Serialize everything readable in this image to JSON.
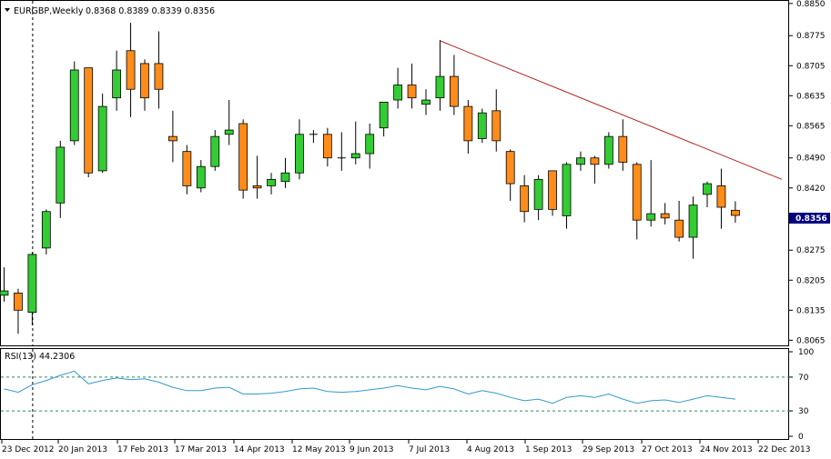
{
  "header": {
    "symbol_label": "EURGBP,Weekly",
    "ohlc_label": "0.8368 0.8389 0.8339 0.8356"
  },
  "rsi_header": {
    "label": "RSI(13) 44.2306"
  },
  "current_price_tag": "0.8356",
  "colors": {
    "bull": "#33cc33",
    "bear": "#ff8c1a",
    "candle_border": "#000000",
    "rsi_line": "#3399cc",
    "trendline": "#b22222",
    "grid": "#7f7f7f",
    "price_tag_bg": "#000080"
  },
  "chart_data": [
    {
      "type": "candlestick",
      "title": "",
      "price_axis_ticks": [
        "0.8850",
        "0.8775",
        "0.8705",
        "0.8635",
        "0.8565",
        "0.8490",
        "0.8420",
        "0.8350",
        "0.8275",
        "0.8205",
        "0.8135",
        "0.8065"
      ],
      "date_axis_ticks": [
        "23 Dec 2012",
        "20 Jan 2013",
        "17 Feb 2013",
        "17 Mar 2013",
        "14 Apr 2013",
        "12 May 2013",
        "9 Jun 2013",
        "7 Jul 2013",
        "4 Aug 2013",
        "1 Sep 2013",
        "29 Sep 2013",
        "27 Oct 2013",
        "24 Nov 2013",
        "22 Dec 2013"
      ],
      "ylim": [
        0.8053,
        0.8856
      ],
      "grid": false,
      "candles": [
        {
          "o": 0.817,
          "h": 0.8235,
          "l": 0.8155,
          "c": 0.818
        },
        {
          "o": 0.8175,
          "h": 0.8185,
          "l": 0.808,
          "c": 0.8135
        },
        {
          "o": 0.813,
          "h": 0.827,
          "l": 0.81,
          "c": 0.8265
        },
        {
          "o": 0.828,
          "h": 0.837,
          "l": 0.8265,
          "c": 0.8365
        },
        {
          "o": 0.8385,
          "h": 0.853,
          "l": 0.835,
          "c": 0.8515
        },
        {
          "o": 0.853,
          "h": 0.8715,
          "l": 0.852,
          "c": 0.8695
        },
        {
          "o": 0.87,
          "h": 0.87,
          "l": 0.8445,
          "c": 0.8455
        },
        {
          "o": 0.846,
          "h": 0.864,
          "l": 0.8455,
          "c": 0.861
        },
        {
          "o": 0.863,
          "h": 0.874,
          "l": 0.86,
          "c": 0.8695
        },
        {
          "o": 0.874,
          "h": 0.8805,
          "l": 0.8585,
          "c": 0.865
        },
        {
          "o": 0.871,
          "h": 0.872,
          "l": 0.86,
          "c": 0.863
        },
        {
          "o": 0.871,
          "h": 0.8785,
          "l": 0.8605,
          "c": 0.865
        },
        {
          "o": 0.854,
          "h": 0.86,
          "l": 0.848,
          "c": 0.853
        },
        {
          "o": 0.8505,
          "h": 0.852,
          "l": 0.8405,
          "c": 0.8425
        },
        {
          "o": 0.842,
          "h": 0.8485,
          "l": 0.841,
          "c": 0.847
        },
        {
          "o": 0.847,
          "h": 0.8555,
          "l": 0.846,
          "c": 0.854
        },
        {
          "o": 0.8545,
          "h": 0.8625,
          "l": 0.852,
          "c": 0.8555
        },
        {
          "o": 0.857,
          "h": 0.858,
          "l": 0.8395,
          "c": 0.8415
        },
        {
          "o": 0.8425,
          "h": 0.8495,
          "l": 0.8395,
          "c": 0.842
        },
        {
          "o": 0.8425,
          "h": 0.8455,
          "l": 0.8405,
          "c": 0.844
        },
        {
          "o": 0.8435,
          "h": 0.849,
          "l": 0.842,
          "c": 0.8455
        },
        {
          "o": 0.8455,
          "h": 0.858,
          "l": 0.844,
          "c": 0.8545
        },
        {
          "o": 0.8545,
          "h": 0.8555,
          "l": 0.8525,
          "c": 0.8545
        },
        {
          "o": 0.8545,
          "h": 0.856,
          "l": 0.847,
          "c": 0.849
        },
        {
          "o": 0.849,
          "h": 0.855,
          "l": 0.846,
          "c": 0.849
        },
        {
          "o": 0.849,
          "h": 0.8575,
          "l": 0.8475,
          "c": 0.85
        },
        {
          "o": 0.85,
          "h": 0.857,
          "l": 0.8465,
          "c": 0.8545
        },
        {
          "o": 0.856,
          "h": 0.862,
          "l": 0.854,
          "c": 0.862
        },
        {
          "o": 0.8625,
          "h": 0.87,
          "l": 0.8605,
          "c": 0.866
        },
        {
          "o": 0.866,
          "h": 0.871,
          "l": 0.8605,
          "c": 0.863
        },
        {
          "o": 0.8615,
          "h": 0.865,
          "l": 0.859,
          "c": 0.8625
        },
        {
          "o": 0.863,
          "h": 0.8765,
          "l": 0.86,
          "c": 0.868
        },
        {
          "o": 0.868,
          "h": 0.873,
          "l": 0.859,
          "c": 0.861
        },
        {
          "o": 0.861,
          "h": 0.8625,
          "l": 0.85,
          "c": 0.853
        },
        {
          "o": 0.8535,
          "h": 0.8605,
          "l": 0.8525,
          "c": 0.8595
        },
        {
          "o": 0.86,
          "h": 0.865,
          "l": 0.8505,
          "c": 0.853
        },
        {
          "o": 0.8505,
          "h": 0.851,
          "l": 0.839,
          "c": 0.843
        },
        {
          "o": 0.8425,
          "h": 0.845,
          "l": 0.834,
          "c": 0.8365
        },
        {
          "o": 0.837,
          "h": 0.845,
          "l": 0.8345,
          "c": 0.844
        },
        {
          "o": 0.846,
          "h": 0.846,
          "l": 0.8355,
          "c": 0.837
        },
        {
          "o": 0.8355,
          "h": 0.848,
          "l": 0.8325,
          "c": 0.8475
        },
        {
          "o": 0.8475,
          "h": 0.8505,
          "l": 0.846,
          "c": 0.849
        },
        {
          "o": 0.849,
          "h": 0.8495,
          "l": 0.843,
          "c": 0.8475
        },
        {
          "o": 0.8475,
          "h": 0.855,
          "l": 0.8465,
          "c": 0.854
        },
        {
          "o": 0.854,
          "h": 0.858,
          "l": 0.846,
          "c": 0.848
        },
        {
          "o": 0.8475,
          "h": 0.848,
          "l": 0.83,
          "c": 0.8345
        },
        {
          "o": 0.8345,
          "h": 0.8485,
          "l": 0.833,
          "c": 0.836
        },
        {
          "o": 0.836,
          "h": 0.8385,
          "l": 0.8335,
          "c": 0.835
        },
        {
          "o": 0.8345,
          "h": 0.839,
          "l": 0.8295,
          "c": 0.8305
        },
        {
          "o": 0.8305,
          "h": 0.84,
          "l": 0.8255,
          "c": 0.838
        },
        {
          "o": 0.8405,
          "h": 0.8435,
          "l": 0.8375,
          "c": 0.843
        },
        {
          "o": 0.8425,
          "h": 0.8465,
          "l": 0.8325,
          "c": 0.8375
        },
        {
          "o": 0.8368,
          "h": 0.8389,
          "l": 0.8339,
          "c": 0.8356
        }
      ],
      "trendline": {
        "from": {
          "index": 31,
          "price": 0.8763
        },
        "to": {
          "index": 55.3,
          "price": 0.844
        }
      },
      "vertical_marker_index": 2
    },
    {
      "type": "line",
      "title": "",
      "ylim": [
        0,
        100
      ],
      "level_ticks": [
        "100",
        "70",
        "30",
        "0"
      ],
      "dotted_levels": [
        70,
        30
      ],
      "series": [
        {
          "values": [
            56,
            52,
            61,
            66,
            72,
            77,
            62,
            66,
            69,
            67,
            68,
            64,
            58,
            54,
            54,
            57,
            58,
            50,
            50,
            51,
            53,
            56,
            57,
            53,
            52,
            53,
            55,
            57,
            60,
            57,
            55,
            59,
            56,
            50,
            54,
            51,
            46,
            42,
            44,
            39,
            46,
            48,
            46,
            50,
            44,
            39,
            42,
            43,
            40,
            44,
            48,
            46,
            44
          ]
        }
      ]
    }
  ]
}
